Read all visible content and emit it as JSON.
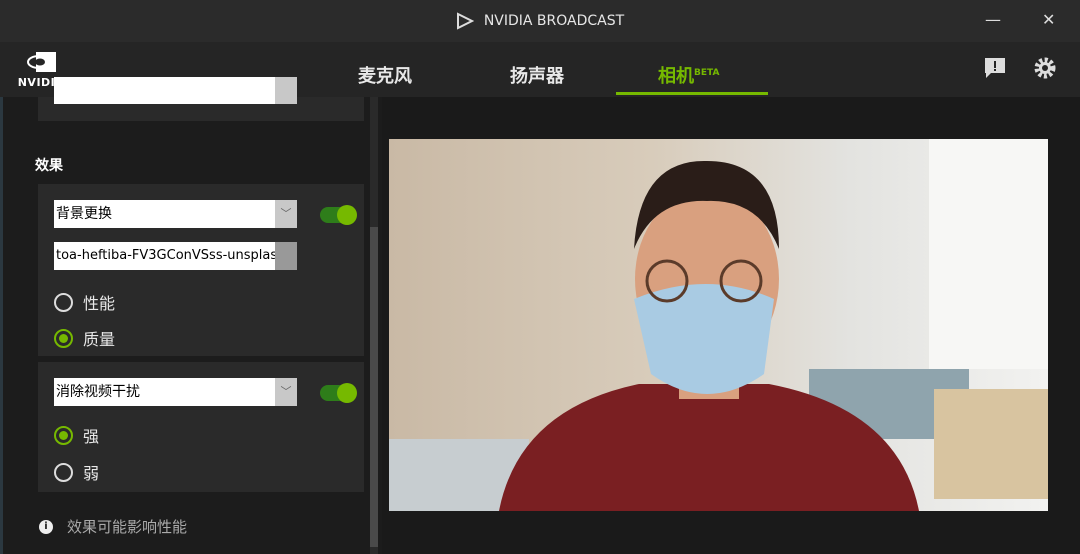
{
  "window": {
    "title": "NVIDIA BROADCAST",
    "minimize": "—",
    "close": "✕"
  },
  "brand": {
    "logo_text": "NVIDIA"
  },
  "tabs": [
    {
      "label": "麦克风"
    },
    {
      "label": "扬声器"
    },
    {
      "label": "相机",
      "badge": "BETA"
    }
  ],
  "section_title": "效果",
  "effect1": {
    "select": "背景更换",
    "file": "toa-heftiba-FV3GConVSss-unsplas",
    "enabled": true,
    "options": [
      {
        "label": "性能",
        "selected": false
      },
      {
        "label": "质量",
        "selected": true
      }
    ]
  },
  "effect2": {
    "select": "消除视频干扰",
    "enabled": true,
    "options": [
      {
        "label": "强",
        "selected": true
      },
      {
        "label": "弱",
        "selected": false
      }
    ]
  },
  "notice": "效果可能影响性能",
  "colors": {
    "accent": "#76b900"
  }
}
